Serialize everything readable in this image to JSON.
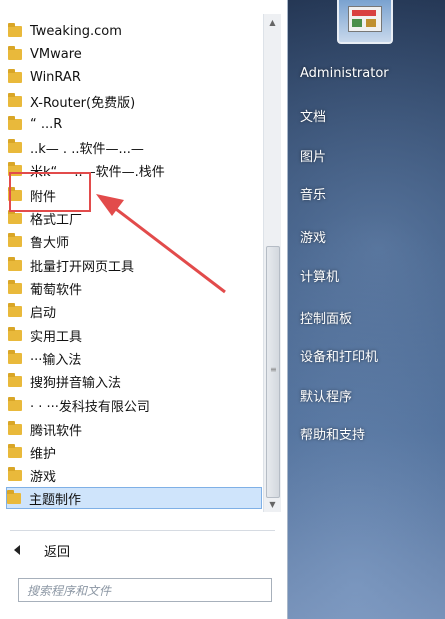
{
  "programs": [
    {
      "label": "Tweaking.com"
    },
    {
      "label": "VMware"
    },
    {
      "label": "WinRAR"
    },
    {
      "label": "X-Router(免费版)"
    },
    {
      "label": "“ ...R"
    },
    {
      "label": "..k— . ..软件—...—"
    },
    {
      "label": "米k“— ..—软件—.栈件"
    },
    {
      "label": "附件"
    },
    {
      "label": "格式工厂"
    },
    {
      "label": "鲁大师"
    },
    {
      "label": "批量打开网页工具"
    },
    {
      "label": "葡萄软件"
    },
    {
      "label": "启动"
    },
    {
      "label": "实用工具"
    },
    {
      "label": "···输入法"
    },
    {
      "label": "搜狗拼音输入法"
    },
    {
      "label": "· · ···发科技有限公司"
    },
    {
      "label": "腾讯软件"
    },
    {
      "label": "维护"
    },
    {
      "label": "游戏"
    },
    {
      "label": "主题制作"
    }
  ],
  "back_label": "返回",
  "search": {
    "placeholder": "搜索程序和文件"
  },
  "right_menu": [
    {
      "label": "Administrator"
    },
    {
      "label": "文档"
    },
    {
      "label": "图片"
    },
    {
      "label": "音乐"
    },
    {
      "label": "游戏"
    },
    {
      "label": "计算机"
    },
    {
      "label": "控制面板"
    },
    {
      "label": "设备和打印机"
    },
    {
      "label": "默认程序"
    },
    {
      "label": "帮助和支持"
    }
  ],
  "colors": {
    "highlight_box": "#e24b4b",
    "selection": "#cfe4fb",
    "folder": "#e9b93b"
  }
}
